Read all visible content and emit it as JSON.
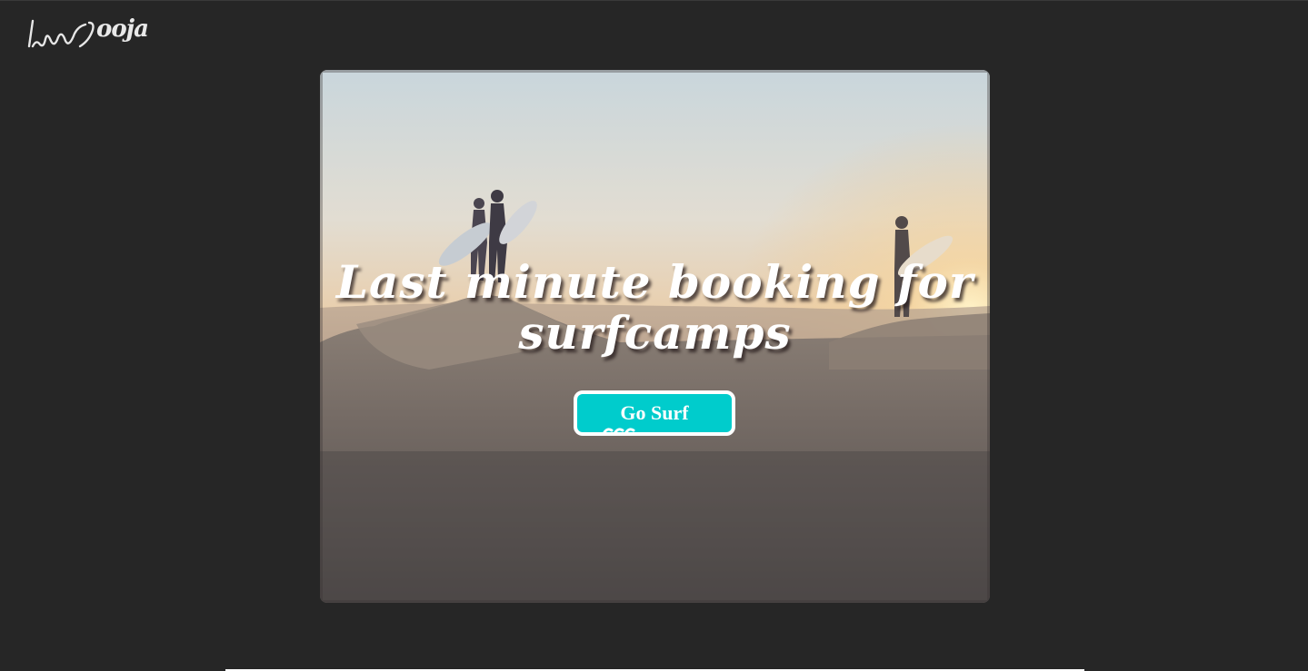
{
  "brand": {
    "logo_text": "ooja",
    "logo_icon": "handwritten-wave-logo"
  },
  "hero": {
    "image_subject": "surfers-at-sunset",
    "title": "Last minute booking for surfcamps",
    "cta_label": "Go Surf",
    "cta_icon": "wave-icon"
  },
  "colors": {
    "page_background": "#262626",
    "cta_background": "#00cccc",
    "cta_border": "#ffffff",
    "title_text": "#ffffff"
  }
}
